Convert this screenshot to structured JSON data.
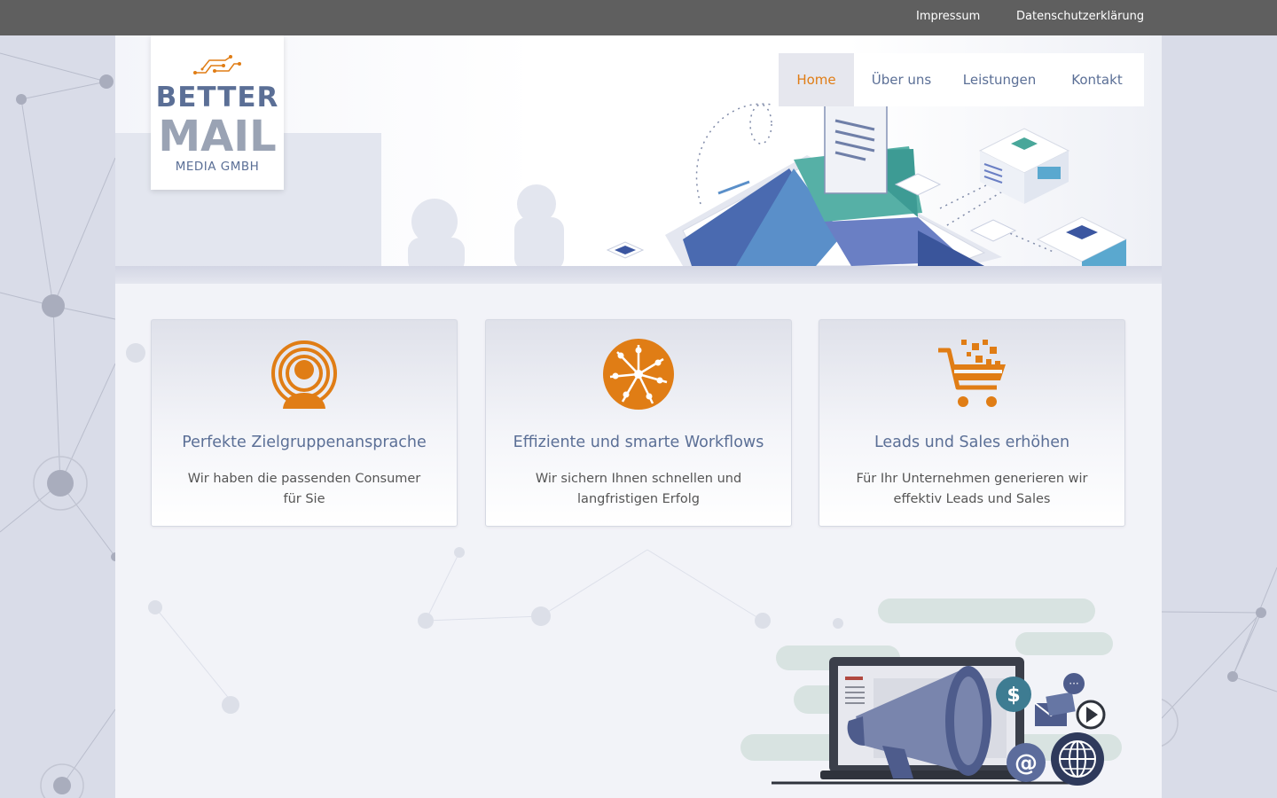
{
  "topbar": {
    "links": [
      {
        "label": "Impressum"
      },
      {
        "label": "Datenschutzerklärung"
      }
    ]
  },
  "logo": {
    "line1": "BETTER",
    "line2": "MAIL",
    "line3": "MEDIA GMBH"
  },
  "nav": {
    "items": [
      {
        "label": "Home",
        "active": true
      },
      {
        "label": "Über uns"
      },
      {
        "label": "Leistungen"
      },
      {
        "label": "Kontakt"
      }
    ]
  },
  "features": [
    {
      "icon": "target-person-icon",
      "title": "Perfekte Zielgruppenansprache",
      "text": "Wir haben die passenden Consumer für Sie"
    },
    {
      "icon": "workflow-network-icon",
      "title": "Effiziente und smarte Workflows",
      "text": "Wir sichern Ihnen schnellen und langfristigen Erfolg"
    },
    {
      "icon": "shopping-cart-icon",
      "title": "Leads und Sales erhöhen",
      "text": "Für Ihr Unternehmen generieren wir effektiv Leads und Sales"
    }
  ],
  "colors": {
    "accent": "#e07d15",
    "brand_blue": "#5b6f96",
    "topbar": "#5f5f5f"
  }
}
